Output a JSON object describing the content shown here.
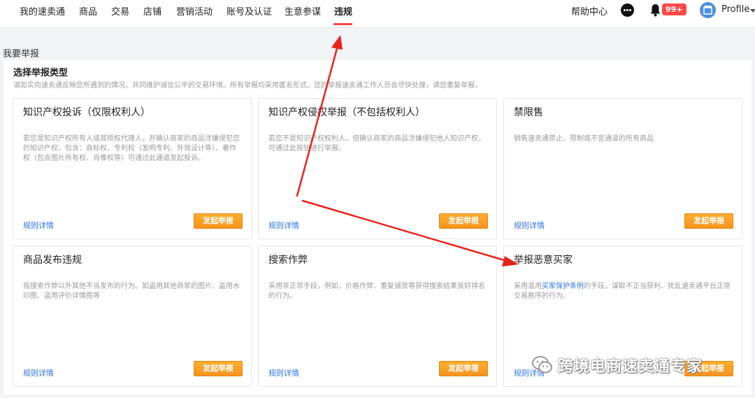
{
  "nav": {
    "items": [
      "我的速卖通",
      "商品",
      "交易",
      "店铺",
      "营销活动",
      "账号及认证",
      "生意参谋",
      "违规"
    ],
    "help": "帮助中心",
    "badge": "99+",
    "profile": "Profile",
    "accent_color": "#ff4747"
  },
  "page": {
    "title": "我要举报"
  },
  "section": {
    "title": "选择举报类型",
    "desc": "请如实向速卖通反映您所遇到的情况，共同维护诚信公平的交易环境。所有举报均采用匿名形式，您的举报速卖通工作人员会尽快处理，请您重复举报。"
  },
  "cards": [
    {
      "title": "知识产权投诉（仅限权利人）",
      "desc": "若您是知识产权所有人或其授权代理人，并确认商家的商品涉嫌侵犯您的知识产权，包含：商标权、专利权（发明专利、外观设计等）、著作权（包含图片所有权、肖像权等）可通过此通道发起投诉。",
      "rules": "规则详情",
      "button": "发起举报"
    },
    {
      "title": "知识产权侵权举报（不包括权利人）",
      "desc": "若您不是知识产权权利人，但确认商家的商品涉嫌侵犯他人知识产权，可通过此按钮进行举报。",
      "rules": "规则详情",
      "button": "发起举报"
    },
    {
      "title": "禁限售",
      "desc": "销售速卖通禁止、限制或不宜通道的所有商品",
      "rules": "规则详情",
      "button": "发起举报"
    },
    {
      "title": "商品发布违规",
      "desc": "指搜索作弊以外其他不当发布的行为。如盗用其他商家的图片、盗用水印图、盗用评价详情图等",
      "rules": "规则详情",
      "button": "发起举报"
    },
    {
      "title": "搜索作弊",
      "desc": "采用非正常手段，例如，价格作弊、重复铺货等获得搜索结果良好排名的行为。",
      "rules": "规则详情",
      "button": "发起举报"
    },
    {
      "title": "举报恶意买家",
      "desc_before": "采用滥用",
      "desc_link": "买家保护条例",
      "desc_after": "的手段，谋取不正当获利、扰乱速卖通平台正常交易秩序的行为。",
      "rules": "规则详情",
      "button": "发起举报"
    }
  ],
  "watermark": {
    "text": "跨境电商速卖通专家"
  }
}
